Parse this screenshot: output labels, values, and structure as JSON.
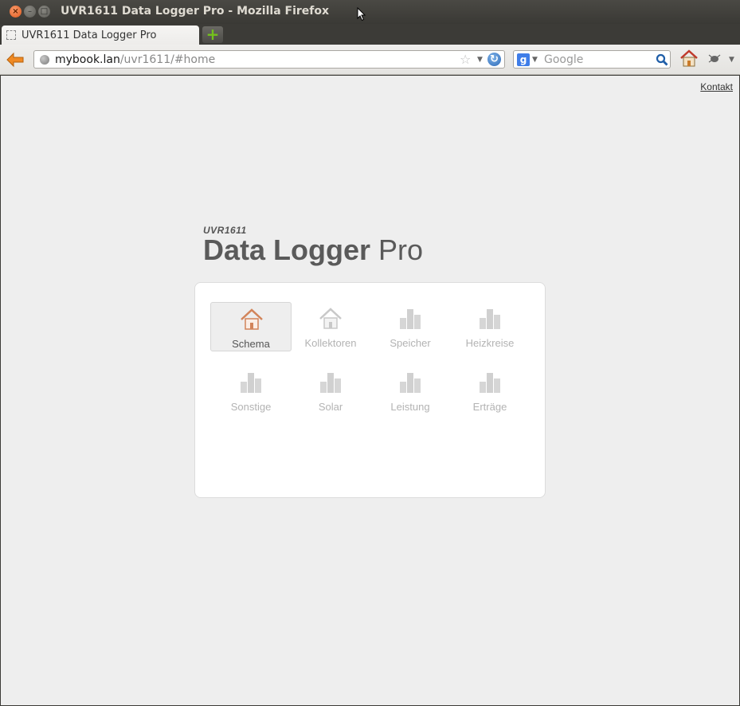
{
  "window": {
    "title": "UVR1611 Data Logger Pro - Mozilla Firefox"
  },
  "tab": {
    "title": "UVR1611 Data Logger Pro",
    "new_tab_label": "+"
  },
  "navbar": {
    "url_host": "mybook.lan",
    "url_path": "/uvr1611/#home",
    "search_placeholder": "Google"
  },
  "page": {
    "kontakt": "Kontakt",
    "logo_small": "UVR1611",
    "logo_main_bold": "Data Logger",
    "logo_main_light": " Pro"
  },
  "menu": {
    "items": [
      {
        "label": "Schema",
        "icon": "home-icon",
        "active": true
      },
      {
        "label": "Kollektoren",
        "icon": "home-icon",
        "active": false
      },
      {
        "label": "Speicher",
        "icon": "chart-icon",
        "active": false
      },
      {
        "label": "Heizkreise",
        "icon": "chart-icon",
        "active": false
      },
      {
        "label": "Sonstige",
        "icon": "chart-icon",
        "active": false
      },
      {
        "label": "Solar",
        "icon": "chart-icon",
        "active": false
      },
      {
        "label": "Leistung",
        "icon": "chart-icon",
        "active": false
      },
      {
        "label": "Erträge",
        "icon": "chart-icon",
        "active": false
      }
    ]
  },
  "colors": {
    "active_home_icon": "#d2845a",
    "inactive_icon": "#d0d0d0",
    "page_background": "#eeeeee"
  }
}
